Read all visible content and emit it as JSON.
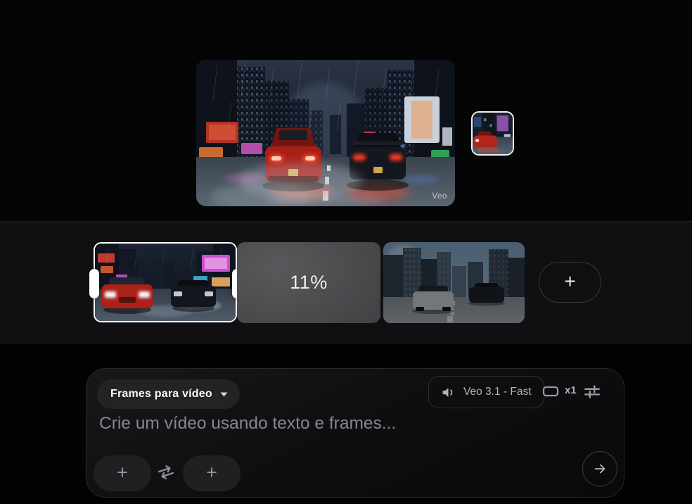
{
  "preview": {
    "watermark": "Veo"
  },
  "timeline": {
    "clips": [
      {
        "name": "night-street-race-clip",
        "state": "selected"
      },
      {
        "name": "generating-clip",
        "progress": "11%"
      },
      {
        "name": "day-highway-clip",
        "state": "dimmed"
      }
    ],
    "add_clip_label": "+"
  },
  "composer": {
    "mode_selector": {
      "label": "Frames para vídeo"
    },
    "model_selector": {
      "label": "Veo 3.1 - Fast"
    },
    "output_count": "x1",
    "prompt_placeholder": "Crie um vídeo usando texto e frames...",
    "add_first_frame_label": "+",
    "add_last_frame_label": "+"
  },
  "icons": {
    "mode_caret": "caret-down",
    "model_audio": "volume-on",
    "aspect": "landscape-frame",
    "settings": "tune-sliders",
    "swap": "swap-arrows",
    "send": "arrow-right",
    "add": "plus"
  },
  "colors": {
    "app_background": "#040404",
    "timeline_background": "#101012",
    "selection_border": "#ffffff",
    "card_border": "#28282b",
    "tail_light_accent": "#ff4a2e"
  }
}
